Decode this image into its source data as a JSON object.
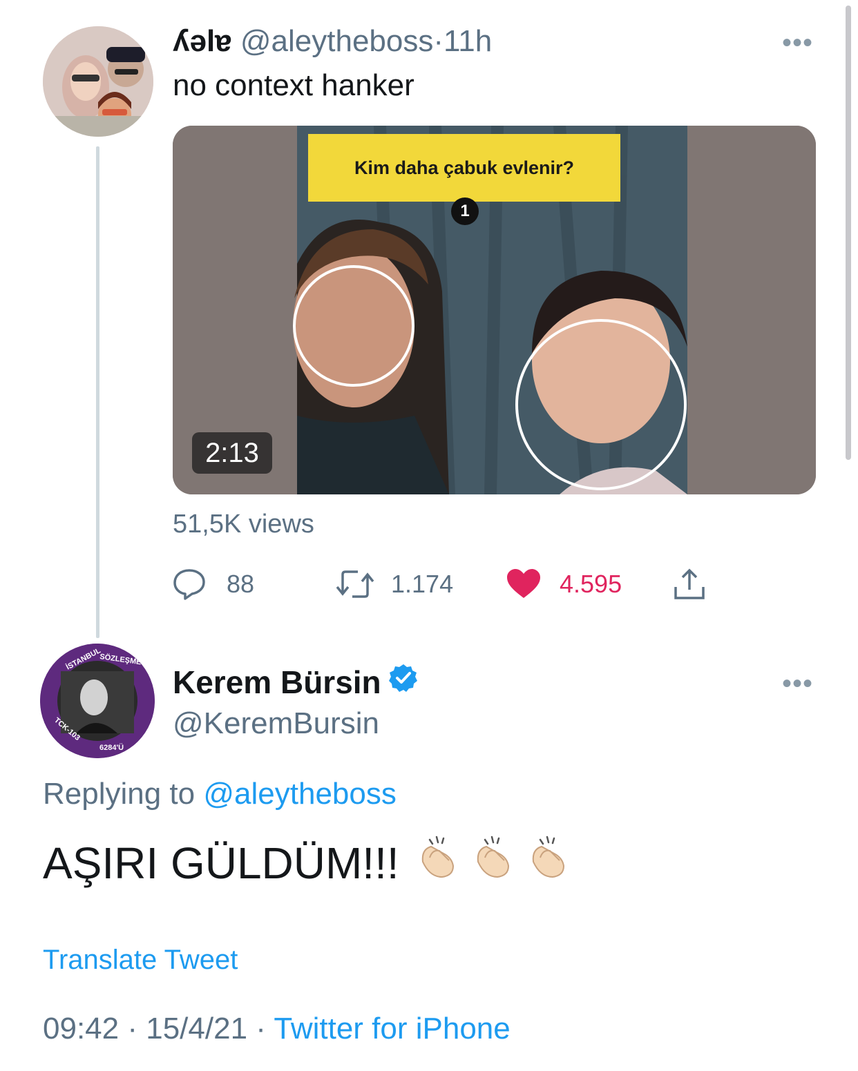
{
  "tweet1": {
    "display_name": "ʎəlɐ",
    "handle": "@aleytheboss",
    "separator": "·",
    "time": "11h",
    "more": "•••",
    "text": "no context hanker",
    "video": {
      "banner_text": "Kim daha çabuk evlenir?",
      "badge": "1",
      "duration": "2:13"
    },
    "views": "51,5K views",
    "actions": {
      "replies": "88",
      "retweets": "1.174",
      "likes": "4.595"
    }
  },
  "tweet2": {
    "display_name": "Kerem Bürsin",
    "handle": "@KeremBursin",
    "more": "•••",
    "replying_prefix": "Replying to",
    "replying_handle": "@aleytheboss",
    "text": "AŞIRI GÜLDÜM!!!",
    "translate": "Translate Tweet",
    "time": "09:42",
    "separator": "·",
    "date": "15/4/21",
    "source": "Twitter for iPhone"
  },
  "colors": {
    "link_blue": "#1d9bf0",
    "like_red": "#e0245e",
    "meta_grey": "#5b7083",
    "banner_yellow": "#f2d83a",
    "avatar_purple": "#5e2a7e"
  },
  "icons": [
    "reply-icon",
    "retweet-icon",
    "like-icon",
    "share-icon",
    "verified-badge-icon",
    "more-icon",
    "clap-icon"
  ]
}
